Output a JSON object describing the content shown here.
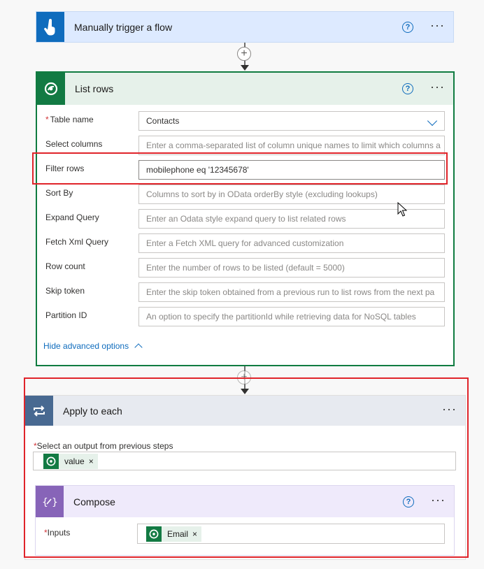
{
  "trigger": {
    "title": "Manually trigger a flow",
    "help_icon": "?",
    "more_icon": "···",
    "icon": "hand-touch-icon"
  },
  "connector_plus": "+",
  "list_rows": {
    "title": "List rows",
    "help_icon": "?",
    "more_icon": "···",
    "icon": "dataverse-icon",
    "fields": [
      {
        "label": "Table name",
        "required": true,
        "value": "Contacts",
        "placeholder": "",
        "type": "dropdown"
      },
      {
        "label": "Select columns",
        "required": false,
        "value": "",
        "placeholder": "Enter a comma-separated list of column unique names to limit which columns a"
      },
      {
        "label": "Filter rows",
        "required": false,
        "value": "mobilephone eq '12345678'",
        "placeholder": ""
      },
      {
        "label": "Sort By",
        "required": false,
        "value": "",
        "placeholder": "Columns to sort by in OData orderBy style (excluding lookups)"
      },
      {
        "label": "Expand Query",
        "required": false,
        "value": "",
        "placeholder": "Enter an Odata style expand query to list related rows"
      },
      {
        "label": "Fetch Xml Query",
        "required": false,
        "value": "",
        "placeholder": "Enter a Fetch XML query for advanced customization"
      },
      {
        "label": "Row count",
        "required": false,
        "value": "",
        "placeholder": "Enter the number of rows to be listed (default = 5000)"
      },
      {
        "label": "Skip token",
        "required": false,
        "value": "",
        "placeholder": "Enter the skip token obtained from a previous run to list rows from the next pa"
      },
      {
        "label": "Partition ID",
        "required": false,
        "value": "",
        "placeholder": "An option to specify the partitionId while retrieving data for NoSQL tables"
      }
    ],
    "advanced_toggle": "Hide advanced options",
    "required_mark": "*"
  },
  "apply_each": {
    "title": "Apply to each",
    "more_icon": "···",
    "icon": "loop-icon",
    "output_label": "Select an output from previous steps",
    "required_mark": "*",
    "token": {
      "label": "value",
      "remove": "×"
    }
  },
  "compose": {
    "title": "Compose",
    "help_icon": "?",
    "more_icon": "···",
    "icon": "compose-icon",
    "inputs_label": "Inputs",
    "required_mark": "*",
    "token": {
      "label": "Email",
      "remove": "×"
    }
  },
  "colors": {
    "trigger_accent": "#0f6cbd",
    "dataverse_green": "#127a43",
    "apply_accent": "#486991",
    "compose_accent": "#8764b8",
    "highlight_red": "#e0242a"
  }
}
